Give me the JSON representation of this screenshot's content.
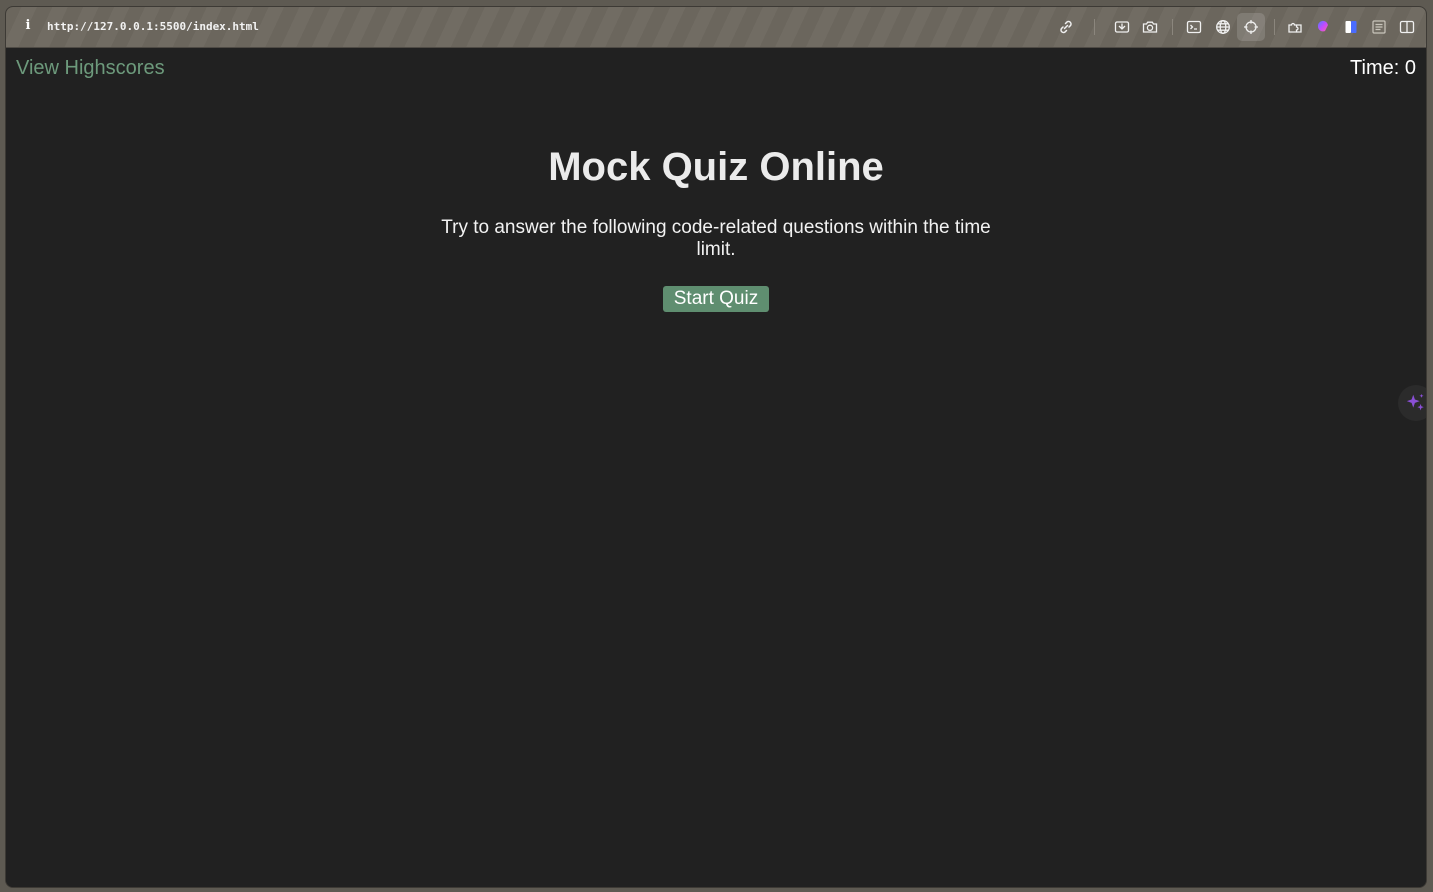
{
  "browser": {
    "url": "http://127.0.0.1:5500/index.html",
    "info_icon_glyph": "i"
  },
  "toolbar_icons": [
    "link-icon",
    "screenshot-area-icon",
    "camera-icon",
    "terminal-icon",
    "globe-icon",
    "crosshair-icon",
    "extensions-icon",
    "colorful-extension-icon",
    "split-color-icon",
    "reader-icon",
    "sidebar-icon"
  ],
  "page": {
    "highscores_link": "View Highscores",
    "timer_label": "Time:",
    "timer_value": "0",
    "title": "Mock Quiz Online",
    "description": "Try to answer the following code-related questions within the time limit.",
    "start_button": "Start Quiz"
  },
  "colors": {
    "background": "#212121",
    "accent_green": "#5f8e70",
    "link_green": "#6d9a7c",
    "sparkle_purple": "#8a4fd6"
  }
}
